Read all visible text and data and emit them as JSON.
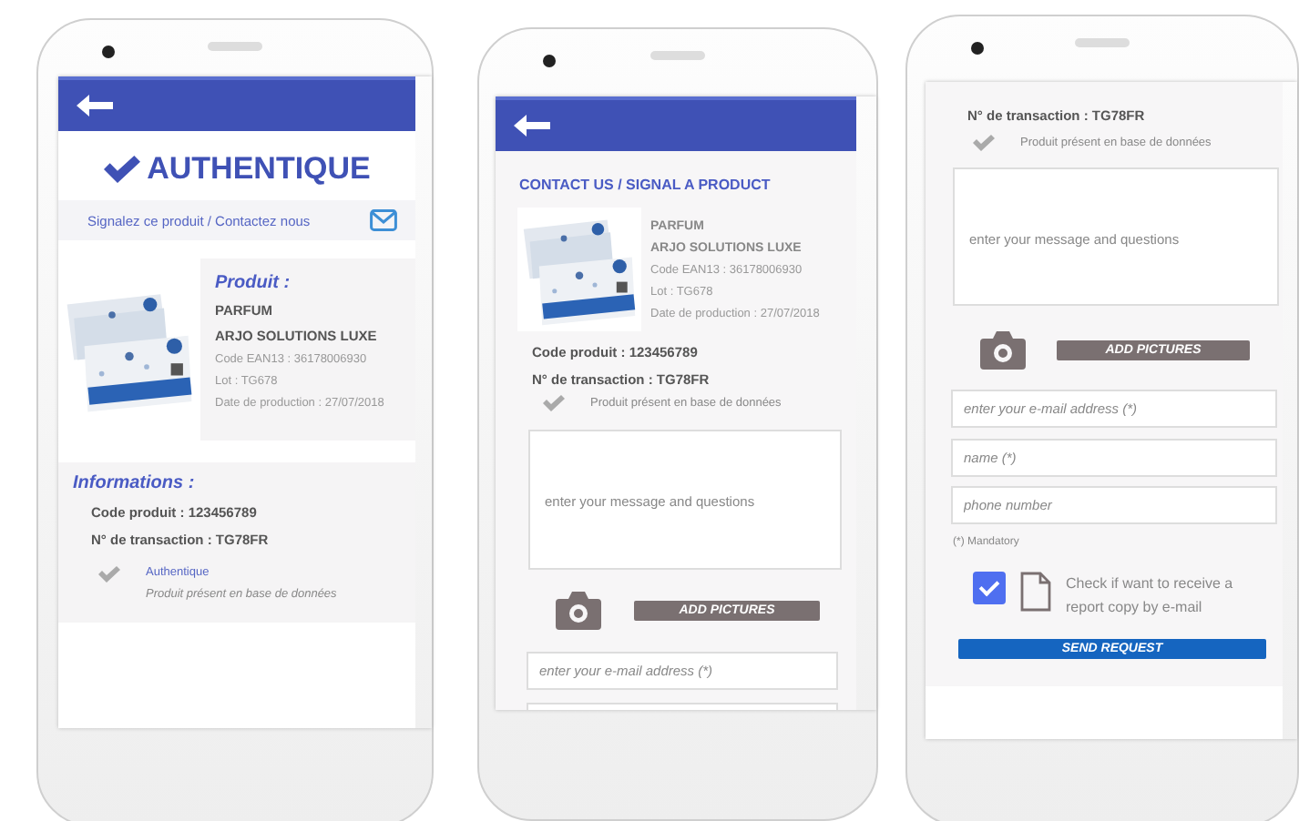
{
  "screens": [
    {
      "kind": "result",
      "status": "AUTHENTIQUE",
      "report_link": "Signalez ce produit / Contactez nous",
      "product": {
        "heading": "Produit :",
        "name": "PARFUM",
        "brand": "ARJO SOLUTIONS LUXE",
        "ean": "Code EAN13 : 36178006930",
        "lot": "Lot :  TG678",
        "date": "Date de production : 27/07/2018"
      },
      "informations": {
        "heading": "Informations :",
        "code": "Code produit : 123456789",
        "transaction": "N° de transaction : TG78FR",
        "status_title": "Authentique",
        "status_note": "Produit présent en base de données"
      }
    },
    {
      "kind": "contact",
      "title": "CONTACT US / SIGNAL A PRODUCT",
      "product": {
        "name": "PARFUM",
        "brand": "ARJO SOLUTIONS LUXE",
        "ean": "Code EAN13 : 36178006930",
        "lot": "Lot :  TG678",
        "date": "Date de production : 27/07/2018"
      },
      "code": "Code produit : 123456789",
      "transaction": "N° de transaction : TG78FR",
      "db_note": "Produit présent en base de données",
      "message_placeholder": "enter your message and questions",
      "add_pictures": "ADD PICTURES",
      "email_placeholder": "enter your e-mail address (*)"
    },
    {
      "kind": "form",
      "transaction": "N° de transaction : TG78FR",
      "db_note": "Produit présent en base de données",
      "message_placeholder": "enter your message and questions",
      "add_pictures": "ADD PICTURES",
      "email_placeholder": "enter your e-mail address (*)",
      "name_placeholder": "name (*)",
      "phone_placeholder": "phone number",
      "mandatory": "(*) Mandatory",
      "report_copy": {
        "label": "Check if want to receive a report copy by e-mail",
        "checked": true
      },
      "send": "SEND REQUEST"
    }
  ]
}
